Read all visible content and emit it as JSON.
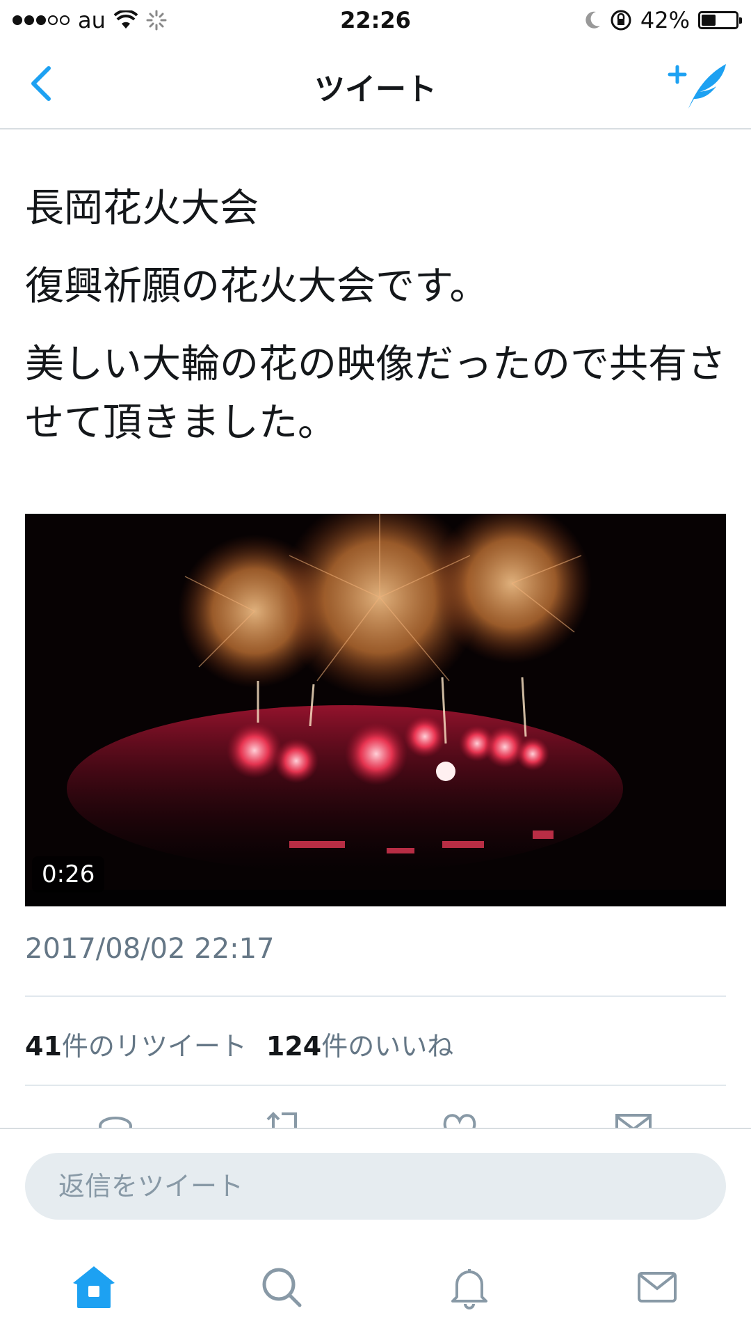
{
  "status_bar": {
    "carrier": "au",
    "time": "22:26",
    "battery": "42%",
    "battery_level": 0.42
  },
  "nav": {
    "title": "ツイート",
    "back_icon": "chevron-left-icon",
    "compose_icon": "compose-tweet-icon"
  },
  "tweet": {
    "lines": [
      "長岡花火大会",
      "復興祈願の花火大会です。",
      "美しい大輪の花の映像だったので共有させて頂きました。"
    ],
    "video_duration": "0:26",
    "timestamp": "2017/08/02 22:17",
    "retweet_count": "41",
    "retweet_label": "件のリツイート",
    "like_count": "124",
    "like_label": "件のいいね"
  },
  "actions": [
    "reply-icon",
    "retweet-icon",
    "like-icon",
    "share-icon"
  ],
  "reply": {
    "placeholder": "返信をツイート"
  },
  "tabbar": {
    "items": [
      "home-icon",
      "search-icon",
      "notifications-icon",
      "messages-icon"
    ],
    "active": "home-icon"
  },
  "colors": {
    "accent": "#1da1f2",
    "text": "#14171a",
    "secondary": "#657786",
    "divider": "#e1e8ed"
  }
}
